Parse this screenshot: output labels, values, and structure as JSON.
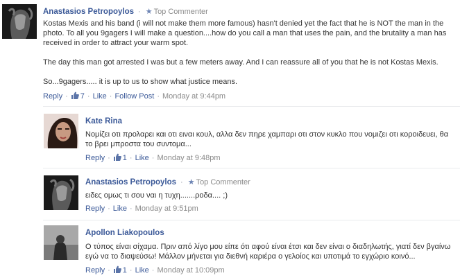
{
  "comments": [
    {
      "author": "Anastasios Petropoylos",
      "badge": "Top Commenter",
      "paragraphs": [
        "Kostas Mexis and his band (i will not make them more famous) hasn't denied yet the fact that he is NOT the man in the photo. To all you 9gagers I will make a question....how do you call a man that uses the pain, and the brutality a man has received in order to attract your warm spot.",
        "The day this man got arrested I was but a few meters away. And I can reassure all of you that he is not Kostas Mexis.",
        "So...9gagers..... it is up to us to show what justice means."
      ],
      "reply": "Reply",
      "likes": "7",
      "like": "Like",
      "follow": "Follow Post",
      "time": "Monday at 9:44pm"
    },
    {
      "author": "Kate Rina",
      "text": "Νομίζει οτι προλαρει και οτι ειναι κουλ, αλλα δεν πηρε χαμπαρι οτι στον κυκλο που νομιζει οτι κοροιδευει, θα το βρει μπροστα του συντομα...",
      "reply": "Reply",
      "likes": "1",
      "like": "Like",
      "time": "Monday at 9:48pm"
    },
    {
      "author": "Anastasios Petropoylos",
      "badge": "Top Commenter",
      "text": "ειδες ομως τι σου ναι η τυχη.......ροδα.... ;)",
      "reply": "Reply",
      "like": "Like",
      "time": "Monday at 9:51pm"
    },
    {
      "author": "Apollon Liakopoulos",
      "text": "Ο τύπος είναι σίχαμα. Πριν από λίγο μου είπε ότι αφού είναι έτσι και δεν είναι ο διαδηλωτής, γιατί δεν βγαίνω εγώ να το διαψεύσω! Μάλλον μήνεται για διεθνή καριέρα ο γελοίος και υποτιμά το εγχώριο κοινό...",
      "reply": "Reply",
      "likes": "1",
      "like": "Like",
      "time": "Monday at 10:09pm"
    }
  ],
  "icons": {
    "badge": "star-icon",
    "likes": "thumbs-up-icon"
  }
}
